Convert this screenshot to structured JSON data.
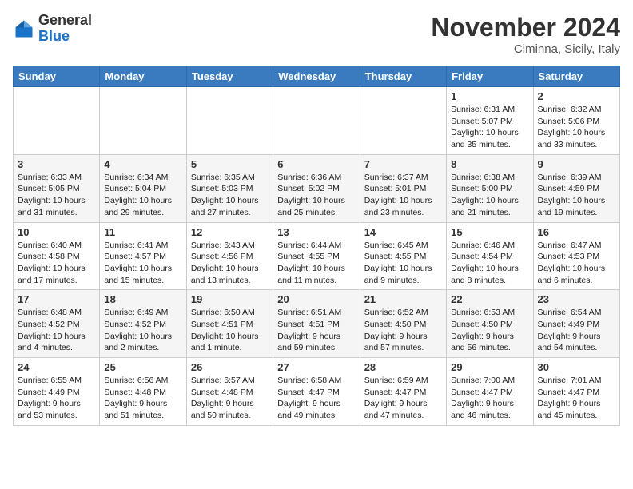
{
  "header": {
    "logo": {
      "general": "General",
      "blue": "Blue"
    },
    "month_title": "November 2024",
    "location": "Ciminna, Sicily, Italy"
  },
  "weekdays": [
    "Sunday",
    "Monday",
    "Tuesday",
    "Wednesday",
    "Thursday",
    "Friday",
    "Saturday"
  ],
  "weeks": [
    [
      {
        "day": "",
        "info": ""
      },
      {
        "day": "",
        "info": ""
      },
      {
        "day": "",
        "info": ""
      },
      {
        "day": "",
        "info": ""
      },
      {
        "day": "",
        "info": ""
      },
      {
        "day": "1",
        "info": "Sunrise: 6:31 AM\nSunset: 5:07 PM\nDaylight: 10 hours\nand 35 minutes."
      },
      {
        "day": "2",
        "info": "Sunrise: 6:32 AM\nSunset: 5:06 PM\nDaylight: 10 hours\nand 33 minutes."
      }
    ],
    [
      {
        "day": "3",
        "info": "Sunrise: 6:33 AM\nSunset: 5:05 PM\nDaylight: 10 hours\nand 31 minutes."
      },
      {
        "day": "4",
        "info": "Sunrise: 6:34 AM\nSunset: 5:04 PM\nDaylight: 10 hours\nand 29 minutes."
      },
      {
        "day": "5",
        "info": "Sunrise: 6:35 AM\nSunset: 5:03 PM\nDaylight: 10 hours\nand 27 minutes."
      },
      {
        "day": "6",
        "info": "Sunrise: 6:36 AM\nSunset: 5:02 PM\nDaylight: 10 hours\nand 25 minutes."
      },
      {
        "day": "7",
        "info": "Sunrise: 6:37 AM\nSunset: 5:01 PM\nDaylight: 10 hours\nand 23 minutes."
      },
      {
        "day": "8",
        "info": "Sunrise: 6:38 AM\nSunset: 5:00 PM\nDaylight: 10 hours\nand 21 minutes."
      },
      {
        "day": "9",
        "info": "Sunrise: 6:39 AM\nSunset: 4:59 PM\nDaylight: 10 hours\nand 19 minutes."
      }
    ],
    [
      {
        "day": "10",
        "info": "Sunrise: 6:40 AM\nSunset: 4:58 PM\nDaylight: 10 hours\nand 17 minutes."
      },
      {
        "day": "11",
        "info": "Sunrise: 6:41 AM\nSunset: 4:57 PM\nDaylight: 10 hours\nand 15 minutes."
      },
      {
        "day": "12",
        "info": "Sunrise: 6:43 AM\nSunset: 4:56 PM\nDaylight: 10 hours\nand 13 minutes."
      },
      {
        "day": "13",
        "info": "Sunrise: 6:44 AM\nSunset: 4:55 PM\nDaylight: 10 hours\nand 11 minutes."
      },
      {
        "day": "14",
        "info": "Sunrise: 6:45 AM\nSunset: 4:55 PM\nDaylight: 10 hours\nand 9 minutes."
      },
      {
        "day": "15",
        "info": "Sunrise: 6:46 AM\nSunset: 4:54 PM\nDaylight: 10 hours\nand 8 minutes."
      },
      {
        "day": "16",
        "info": "Sunrise: 6:47 AM\nSunset: 4:53 PM\nDaylight: 10 hours\nand 6 minutes."
      }
    ],
    [
      {
        "day": "17",
        "info": "Sunrise: 6:48 AM\nSunset: 4:52 PM\nDaylight: 10 hours\nand 4 minutes."
      },
      {
        "day": "18",
        "info": "Sunrise: 6:49 AM\nSunset: 4:52 PM\nDaylight: 10 hours\nand 2 minutes."
      },
      {
        "day": "19",
        "info": "Sunrise: 6:50 AM\nSunset: 4:51 PM\nDaylight: 10 hours\nand 1 minute."
      },
      {
        "day": "20",
        "info": "Sunrise: 6:51 AM\nSunset: 4:51 PM\nDaylight: 9 hours\nand 59 minutes."
      },
      {
        "day": "21",
        "info": "Sunrise: 6:52 AM\nSunset: 4:50 PM\nDaylight: 9 hours\nand 57 minutes."
      },
      {
        "day": "22",
        "info": "Sunrise: 6:53 AM\nSunset: 4:50 PM\nDaylight: 9 hours\nand 56 minutes."
      },
      {
        "day": "23",
        "info": "Sunrise: 6:54 AM\nSunset: 4:49 PM\nDaylight: 9 hours\nand 54 minutes."
      }
    ],
    [
      {
        "day": "24",
        "info": "Sunrise: 6:55 AM\nSunset: 4:49 PM\nDaylight: 9 hours\nand 53 minutes."
      },
      {
        "day": "25",
        "info": "Sunrise: 6:56 AM\nSunset: 4:48 PM\nDaylight: 9 hours\nand 51 minutes."
      },
      {
        "day": "26",
        "info": "Sunrise: 6:57 AM\nSunset: 4:48 PM\nDaylight: 9 hours\nand 50 minutes."
      },
      {
        "day": "27",
        "info": "Sunrise: 6:58 AM\nSunset: 4:47 PM\nDaylight: 9 hours\nand 49 minutes."
      },
      {
        "day": "28",
        "info": "Sunrise: 6:59 AM\nSunset: 4:47 PM\nDaylight: 9 hours\nand 47 minutes."
      },
      {
        "day": "29",
        "info": "Sunrise: 7:00 AM\nSunset: 4:47 PM\nDaylight: 9 hours\nand 46 minutes."
      },
      {
        "day": "30",
        "info": "Sunrise: 7:01 AM\nSunset: 4:47 PM\nDaylight: 9 hours\nand 45 minutes."
      }
    ]
  ]
}
